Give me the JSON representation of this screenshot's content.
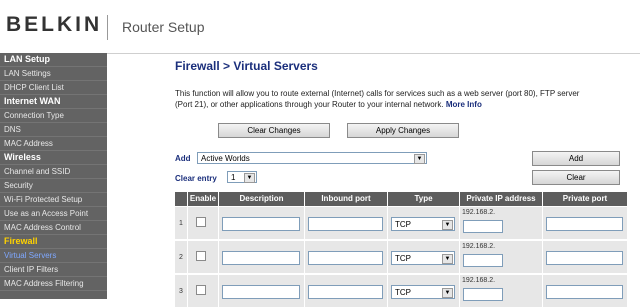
{
  "header": {
    "logo": "BELKIN",
    "title": "Router Setup"
  },
  "sidebar": {
    "items": [
      {
        "label": "LAN Setup",
        "kind": "head",
        "active": false
      },
      {
        "label": "LAN Settings",
        "kind": "item",
        "active": false
      },
      {
        "label": "DHCP Client List",
        "kind": "item",
        "active": false
      },
      {
        "label": "Internet WAN",
        "kind": "head",
        "active": false
      },
      {
        "label": "Connection Type",
        "kind": "item",
        "active": false
      },
      {
        "label": "DNS",
        "kind": "item",
        "active": false
      },
      {
        "label": "MAC Address",
        "kind": "item",
        "active": false
      },
      {
        "label": "Wireless",
        "kind": "head",
        "active": false
      },
      {
        "label": "Channel and SSID",
        "kind": "item",
        "active": false
      },
      {
        "label": "Security",
        "kind": "item",
        "active": false
      },
      {
        "label": "Wi-Fi Protected Setup",
        "kind": "item",
        "active": false
      },
      {
        "label": "Use as an Access Point",
        "kind": "item",
        "active": false
      },
      {
        "label": "MAC Address Control",
        "kind": "item",
        "active": false
      },
      {
        "label": "Firewall",
        "kind": "head",
        "active": true
      },
      {
        "label": "Virtual Servers",
        "kind": "item",
        "active": true
      },
      {
        "label": "Client IP Filters",
        "kind": "item",
        "active": false
      },
      {
        "label": "MAC Address Filtering",
        "kind": "item",
        "active": false
      }
    ]
  },
  "main": {
    "title": "Firewall > Virtual Servers",
    "description": "This function will allow you to route external (Internet) calls for services such as a web server (port 80), FTP server (Port 21), or other applications through your Router to your internal network.",
    "more_info": "More Info",
    "clear_changes": "Clear Changes",
    "apply_changes": "Apply Changes",
    "add_label": "Add",
    "add_select": "Active Worlds",
    "add_button": "Add",
    "clear_entry_label": "Clear entry",
    "clear_entry_select": "1",
    "clear_button": "Clear"
  },
  "table": {
    "headers": [
      "Enable",
      "Description",
      "Inbound port",
      "Type",
      "Private IP address",
      "Private port"
    ],
    "rows": [
      {
        "num": "1",
        "type": "TCP",
        "ip_prefix": "192.168.2."
      },
      {
        "num": "2",
        "type": "TCP",
        "ip_prefix": "192.168.2."
      },
      {
        "num": "3",
        "type": "TCP",
        "ip_prefix": "192.168.2."
      }
    ]
  }
}
